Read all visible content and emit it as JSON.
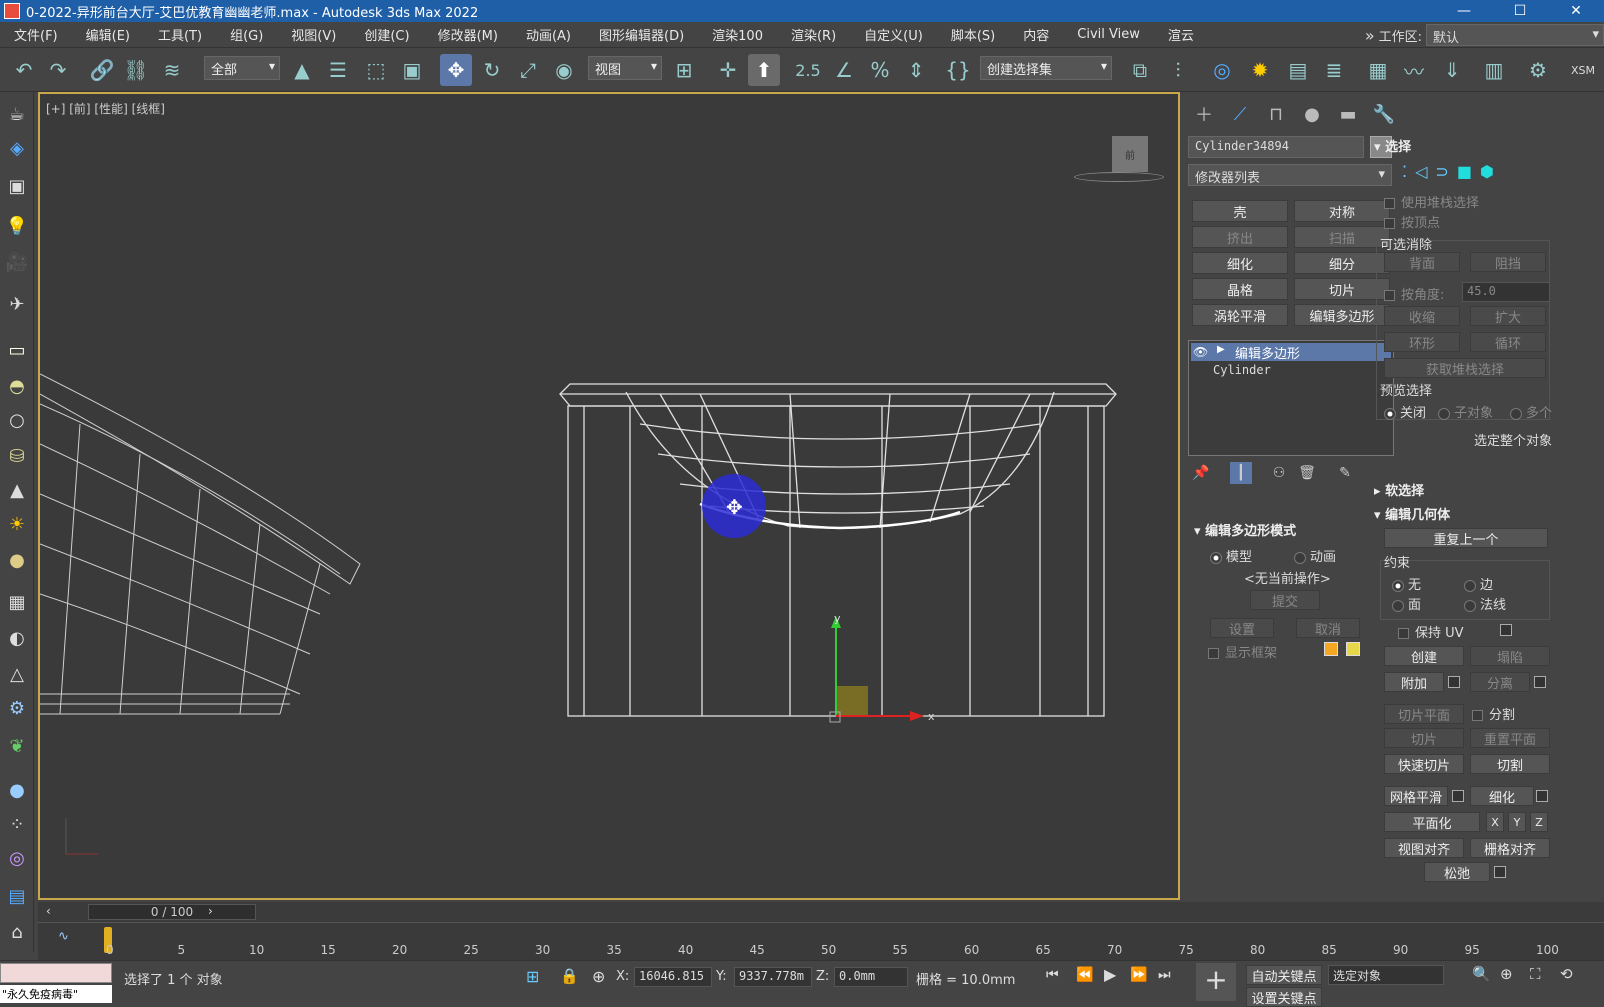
{
  "title": "0-2022-异形前台大厅-艾巴优教育幽幽老师.max - Autodesk 3ds Max 2022",
  "window_buttons": [
    "—",
    "☐",
    "✕"
  ],
  "menu": [
    "文件(F)",
    "编辑(E)",
    "工具(T)",
    "组(G)",
    "视图(V)",
    "创建(C)",
    "修改器(M)",
    "动画(A)",
    "图形编辑器(D)",
    "渲染100",
    "渲染(R)",
    "自定义(U)",
    "脚本(S)",
    "内容",
    "Civil View",
    "渲云"
  ],
  "menu_more": "»",
  "workspace_label": "工作区:",
  "workspace_value": "默认",
  "toolbar": {
    "selection_filter": "全部",
    "ref_coord": "视图",
    "snap_label": "2.5",
    "named_sel": "创建选择集",
    "xsm": "XSM"
  },
  "viewport": {
    "label": "[+] [前] [性能] [线框]",
    "viewcube": "前",
    "axis_y": "y",
    "axis_x": "x"
  },
  "cmd": {
    "object_name": "Cylinder34894",
    "modifier_list": "修改器列表",
    "modifier_buttons": [
      "壳",
      "对称",
      "挤出",
      "扫描",
      "细化",
      "细分",
      "晶格",
      "切片",
      "涡轮平滑",
      "编辑多边形"
    ],
    "stack_selected": "编辑多边形",
    "stack_base": "Cylinder",
    "epm_title": "编辑多边形模式",
    "epm_model": "模型",
    "epm_anim": "动画",
    "epm_noop": "<无当前操作>",
    "epm_commit": "提交",
    "epm_settings": "设置",
    "epm_cancel": "取消",
    "epm_showcage": "显示框架"
  },
  "sel": {
    "title": "选择",
    "use_stack": "使用堆栈选择",
    "by_vertex": "按顶点",
    "ignore_group": "可选消除",
    "backface": "背面",
    "occluded": "阻挡",
    "by_angle": "按角度:",
    "angle_val": "45.0",
    "shrink": "收缩",
    "grow": "扩大",
    "ring": "环形",
    "loop": "循环",
    "get_stack": "获取堆栈选择",
    "preview": "预览选择",
    "prev_off": "关闭",
    "prev_sub": "子对象",
    "prev_multi": "多个",
    "whole_obj": "选定整个对象"
  },
  "soft": {
    "title": "软选择"
  },
  "geo": {
    "title": "编辑几何体",
    "repeat": "重复上一个",
    "constraint": "约束",
    "c_none": "无",
    "c_edge": "边",
    "c_face": "面",
    "c_normal": "法线",
    "keep_uv": "保持 UV",
    "create": "创建",
    "collapse": "塌陷",
    "attach": "附加",
    "detach": "分离",
    "slice_plane": "切片平面",
    "split": "分割",
    "slice": "切片",
    "reset_plane": "重置平面",
    "quickslice": "快速切片",
    "cut": "切割",
    "meshsmooth": "网格平滑",
    "tessellate": "细化",
    "planarize": "平面化",
    "x": "X",
    "y": "Y",
    "z": "Z",
    "view_align": "视图对齐",
    "grid_align": "栅格对齐",
    "relax": "松弛"
  },
  "time": {
    "slider": "0 / 100",
    "ticks": [
      "0",
      "5",
      "10",
      "15",
      "20",
      "25",
      "30",
      "35",
      "40",
      "45",
      "50",
      "55",
      "60",
      "65",
      "70",
      "75",
      "80",
      "85",
      "90",
      "95",
      "100"
    ]
  },
  "status": {
    "maxscript": "\"永久免疫病毒\"",
    "selected": "选择了 1 个 对象",
    "x_label": "X:",
    "x_val": "16046.815",
    "y_label": "Y:",
    "y_val": "9337.778m",
    "z_label": "Z:",
    "z_val": "0.0mm",
    "grid": "栅格 = 10.0mm",
    "autokey": "自动关键点",
    "setkey_filter": "选定对象",
    "setkey": "设置关键点"
  }
}
